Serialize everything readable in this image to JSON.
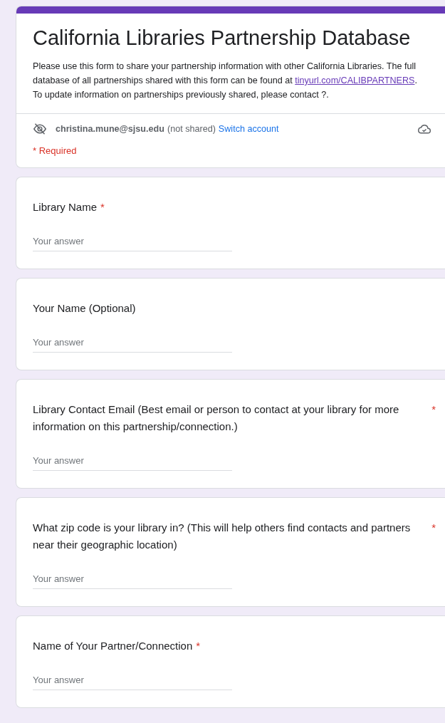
{
  "form": {
    "title": "California Libraries Partnership Database",
    "description_parts": [
      {
        "kind": "text",
        "text": "Please use this form to share your partnership information with other California Libraries. The full database of all partnerships shared with this form can be found at "
      },
      {
        "kind": "link",
        "text": "tinyurl.com/CALIBPARTNERS"
      },
      {
        "kind": "text",
        "text": ". To update information on partnerships previously shared, please contact ?."
      }
    ],
    "account": {
      "email": "christina.mune@sjsu.edu",
      "note": "(not shared)",
      "switch_link": "Switch account"
    },
    "required_note": "* Required"
  },
  "questions": [
    {
      "label": "Library Name",
      "required": true,
      "placeholder": "Your answer"
    },
    {
      "label": "Your Name (Optional)",
      "required": false,
      "placeholder": "Your answer"
    },
    {
      "label": "Library Contact Email (Best email or person to contact at your library for more information on this partnership/connection.)",
      "required": true,
      "placeholder": "Your answer"
    },
    {
      "label": "What zip code is your library in? (This will help others find contacts and partners near their geographic location)",
      "required": true,
      "placeholder": "Your answer"
    },
    {
      "label": "Name of Your Partner/Connection",
      "required": true,
      "placeholder": "Your answer"
    }
  ],
  "required_mark": "*"
}
